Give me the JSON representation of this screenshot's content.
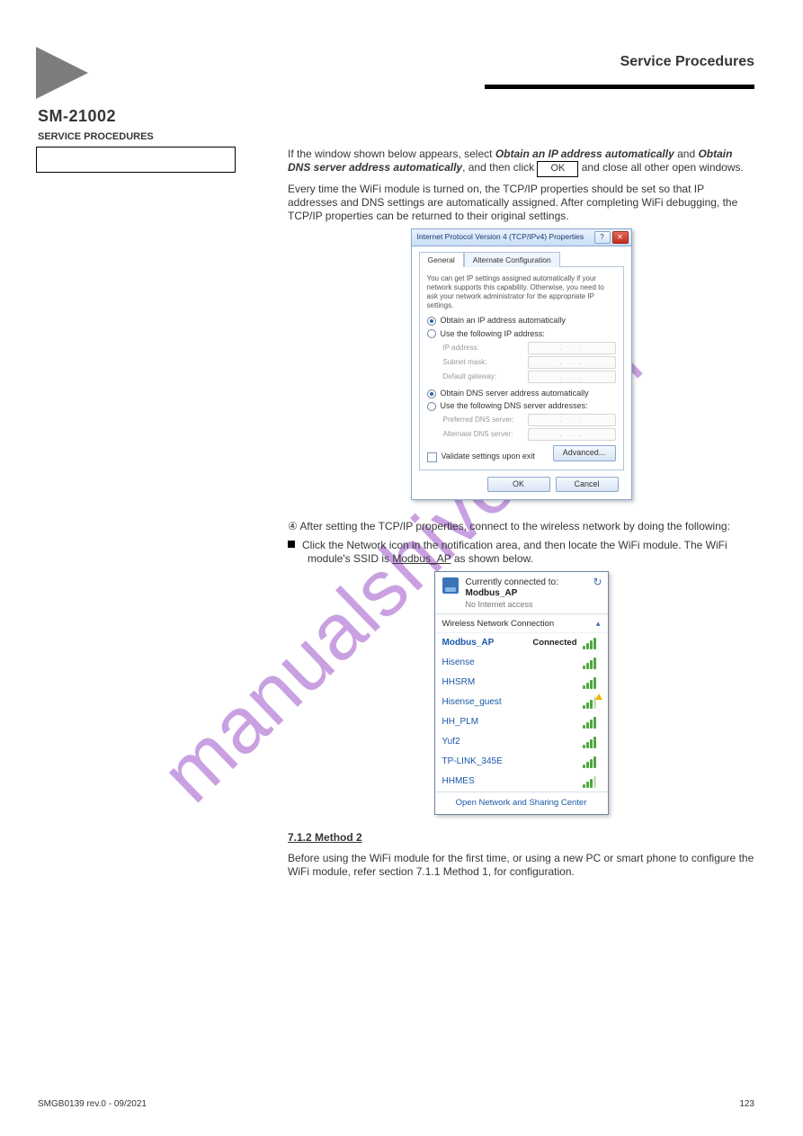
{
  "header": {
    "section_code": "SM-21002",
    "section_label": "SERVICE PROCEDURES",
    "title": "Service Procedures",
    "side_box": ""
  },
  "body": {
    "intro1": "If the window shown below appears, select",
    "intro1_em1": "Obtain an IP address automatically",
    "intro1_mid": " and ",
    "intro1_em2": "Obtain DNS server address automatically",
    "intro1_tail1": ", and then click ",
    "ok_label": "OK",
    "intro1_tail2": " and close all other open windows.",
    "intro2": "Every time the WiFi module is turned on, the TCP/IP properties should be set so that IP addresses and DNS settings are automatically assigned. After completing WiFi debugging, the TCP/IP properties can be returned to their original settings.",
    "step4": "④ After setting the TCP/IP properties, connect to the wireless network by doing the following:",
    "bullet1": "Click the Network icon in the notification area, and then locate the WiFi module. The WiFi module's SSID is ",
    "bullet1_ssid": "Modbus_AP",
    "bullet1_tail": " as shown below.",
    "noteHeading": "7.1.2 Method 2",
    "noteBody": "Before using the WiFi module for the first time, or using a new PC or smart phone to configure the WiFi module, refer section 7.1.1 Method 1, for configuration."
  },
  "ipv4": {
    "title": "Internet Protocol Version 4 (TCP/IPv4) Properties",
    "helpGlyph": "?",
    "closeGlyph": "✕",
    "tabs": {
      "general": "General",
      "alt": "Alternate Configuration"
    },
    "intro": "You can get IP settings assigned automatically if your network supports this capability. Otherwise, you need to ask your network administrator for the appropriate IP settings.",
    "r1": "Obtain an IP address automatically",
    "r2": "Use the following IP address:",
    "ip": "IP address:",
    "mask": "Subnet mask:",
    "gw": "Default gateway:",
    "r3": "Obtain DNS server address automatically",
    "r4": "Use the following DNS server addresses:",
    "pdns": "Preferred DNS server:",
    "adns": "Alternate DNS server:",
    "validate": "Validate settings upon exit",
    "advanced": "Advanced...",
    "ok": "OK",
    "cancel": "Cancel"
  },
  "wifi": {
    "currently": "Currently connected to:",
    "active_ssid": "Modbus_AP",
    "active_sub": "No Internet access",
    "sectionLabel": "Wireless Network Connection",
    "connected_status": "Connected",
    "footer": "Open Network and Sharing Center",
    "networks": [
      {
        "ssid": "Modbus_AP",
        "connected": true,
        "bars": 4,
        "warn": false
      },
      {
        "ssid": "Hisense",
        "connected": false,
        "bars": 4,
        "warn": false
      },
      {
        "ssid": "HHSRM",
        "connected": false,
        "bars": 4,
        "warn": false
      },
      {
        "ssid": "Hisense_guest",
        "connected": false,
        "bars": 3,
        "warn": true
      },
      {
        "ssid": "HH_PLM",
        "connected": false,
        "bars": 4,
        "warn": false
      },
      {
        "ssid": "Yuf2",
        "connected": false,
        "bars": 4,
        "warn": false
      },
      {
        "ssid": "TP-LINK_345E",
        "connected": false,
        "bars": 4,
        "warn": false
      },
      {
        "ssid": "HHMES",
        "connected": false,
        "bars": 3,
        "warn": false
      }
    ]
  },
  "footer": {
    "left": "SMGB0139 rev.0 - 09/2021",
    "right": "123"
  },
  "watermark": "manualshive.com"
}
